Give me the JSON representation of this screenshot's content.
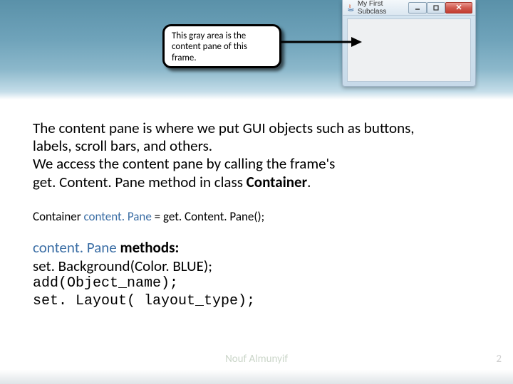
{
  "callout": {
    "text": "This gray area is the content pane of this frame."
  },
  "window": {
    "title": "My First Subclass"
  },
  "body": {
    "line1": "The content pane is where we put GUI objects such as buttons,",
    "line2": "labels, scroll bars, and others.",
    "line3": "We access the content pane by calling the frame's",
    "line4a": "get. Content. Pane method in class ",
    "line4b": "Container",
    "line4c": "."
  },
  "decl": {
    "a": "Container",
    "b": " content. Pane ",
    "c": "= get. Content. Pane();"
  },
  "methods": {
    "title_a": "content. Pane ",
    "title_b": "methods:",
    "m1": "set. Background(Color. BLUE);",
    "m2": "add(Object_name);",
    "m3": "set. Layout( layout_type);"
  },
  "footer": {
    "watermark": "Nouf Almunyif",
    "page": "2"
  }
}
